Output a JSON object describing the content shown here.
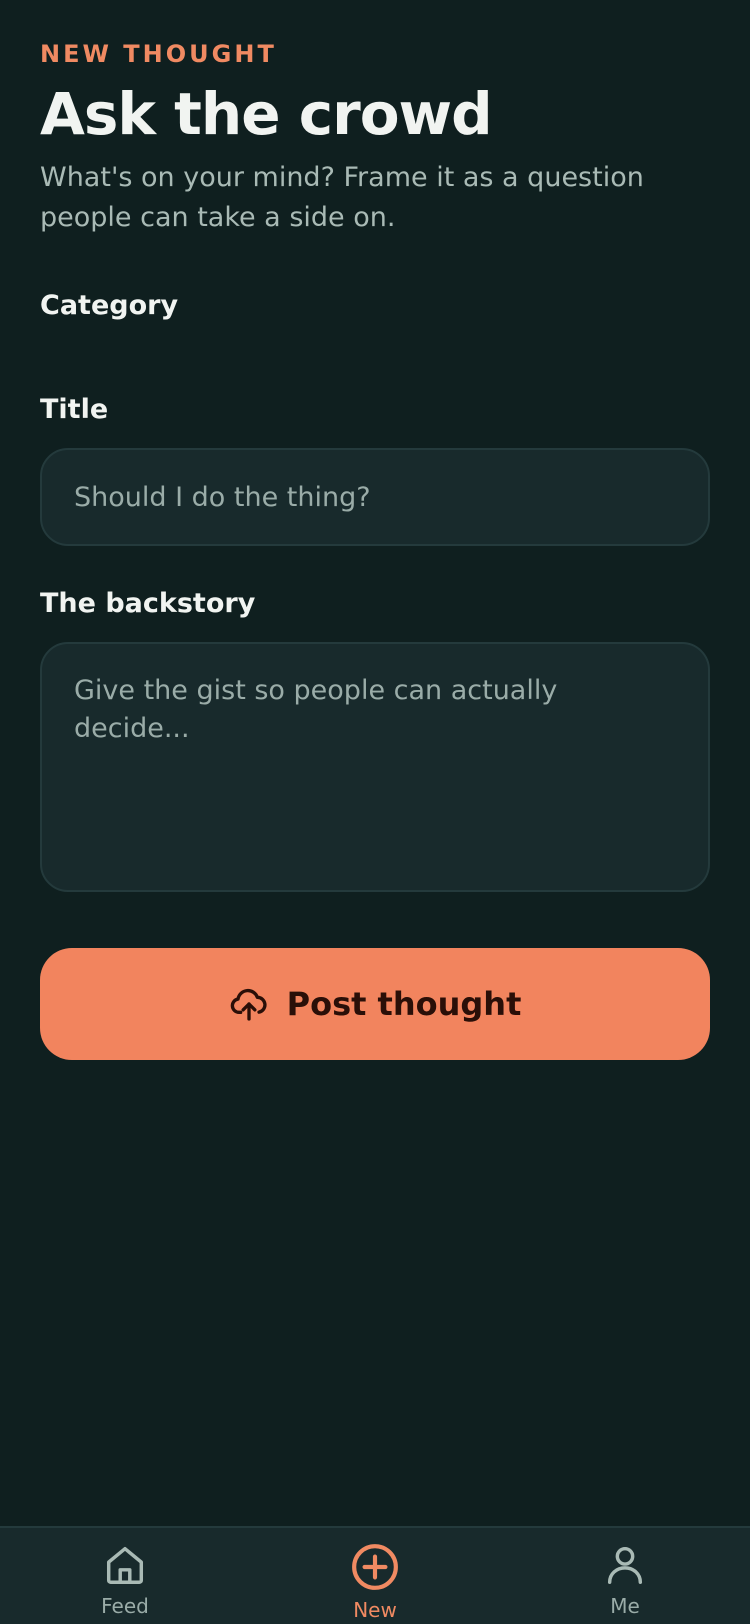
{
  "header": {
    "eyebrow": "NEW THOUGHT",
    "title": "Ask the crowd",
    "subtitle": "What's on your mind? Frame it as a question people can take a side on."
  },
  "form": {
    "category_label": "Category",
    "title_label": "Title",
    "title_placeholder": "Should I do the thing?",
    "title_value": "",
    "backstory_label": "The backstory",
    "backstory_placeholder": "Give the gist so people can actually decide...",
    "backstory_value": ""
  },
  "post_button": {
    "label": "Post thought",
    "icon": "cloud-upload-icon"
  },
  "tabbar": {
    "items": [
      {
        "label": "Feed",
        "icon": "home-icon",
        "active": false
      },
      {
        "label": "New",
        "icon": "plus-circle-icon",
        "active": true
      },
      {
        "label": "Me",
        "icon": "user-icon",
        "active": false
      }
    ]
  },
  "colors": {
    "background": "#0f1f1f",
    "surface": "#182a2c",
    "accent": "#f2845e",
    "text_primary": "#f1f4f1",
    "text_secondary": "#a9bab5"
  }
}
